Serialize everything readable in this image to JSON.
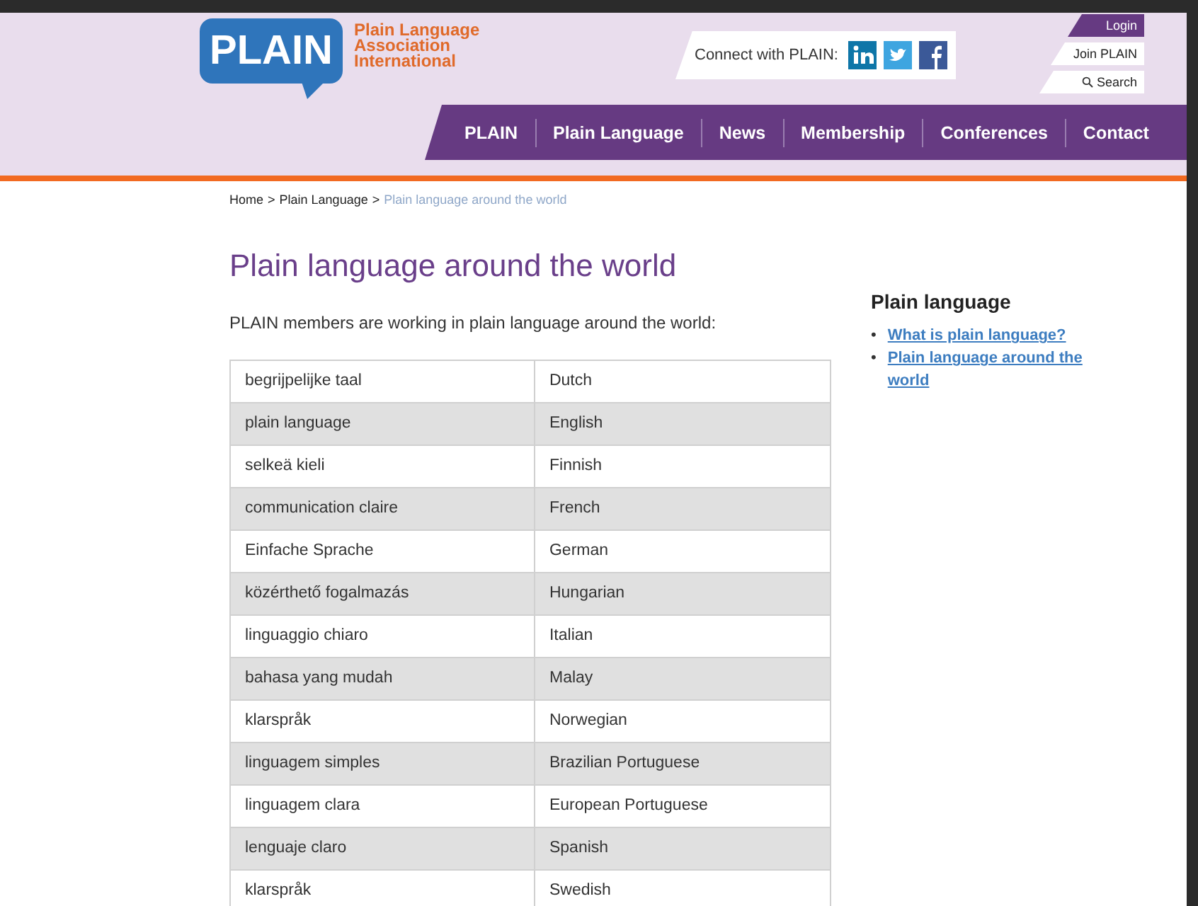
{
  "header": {
    "logo_text": "PLAIN",
    "org_name": [
      "Plain Language",
      "Association",
      "International"
    ],
    "connect_label": "Connect with PLAIN:",
    "utility_links": [
      {
        "label": "Login",
        "kind": "filled"
      },
      {
        "label": "Join PLAIN",
        "kind": "plain"
      },
      {
        "label": "Search",
        "kind": "search"
      }
    ],
    "nav": [
      {
        "label": "PLAIN"
      },
      {
        "label": "Plain Language"
      },
      {
        "label": "News"
      },
      {
        "label": "Membership"
      },
      {
        "label": "Conferences"
      },
      {
        "label": "Contact"
      }
    ]
  },
  "breadcrumb": {
    "separator": ">",
    "items": [
      {
        "label": "Home",
        "current": false
      },
      {
        "label": "Plain Language",
        "current": false
      },
      {
        "label": "Plain language around the world",
        "current": true
      }
    ]
  },
  "main": {
    "title": "Plain language around the world",
    "intro": "PLAIN members are working in plain language around the world:",
    "table": {
      "rows": [
        [
          "begrijpelijke taal",
          "Dutch"
        ],
        [
          "plain language",
          "English"
        ],
        [
          "selkeä kieli",
          "Finnish"
        ],
        [
          "communication claire",
          "French"
        ],
        [
          "Einfache Sprache",
          "German"
        ],
        [
          "közérthető fogalmazás",
          "Hungarian"
        ],
        [
          "linguaggio chiaro",
          "Italian"
        ],
        [
          "bahasa yang mudah",
          "Malay"
        ],
        [
          "klarspråk",
          "Norwegian"
        ],
        [
          "linguagem simples",
          "Brazilian Portuguese"
        ],
        [
          "linguagem clara",
          "European Portuguese"
        ],
        [
          "lenguaje claro",
          "Spanish"
        ],
        [
          "klarspråk",
          "Swedish"
        ]
      ]
    }
  },
  "sidebar": {
    "heading": "Plain language",
    "bullet": "•",
    "links": [
      {
        "label": "What is plain language?"
      },
      {
        "label": "Plain language around the world"
      }
    ]
  }
}
